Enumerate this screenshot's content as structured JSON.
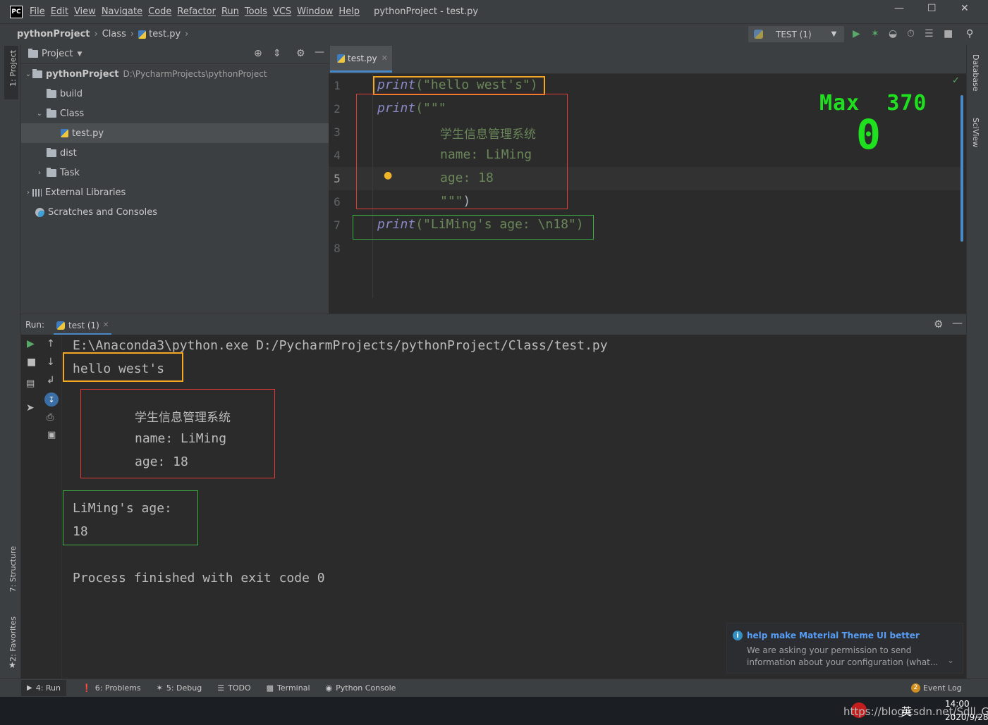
{
  "titlebar": {
    "app_icon": "PC",
    "menu": [
      "File",
      "Edit",
      "View",
      "Navigate",
      "Code",
      "Refactor",
      "Run",
      "Tools",
      "VCS",
      "Window",
      "Help"
    ],
    "title": "pythonProject - test.py"
  },
  "breadcrumb": {
    "project": "pythonProject",
    "folder": "Class",
    "file": "test.py"
  },
  "run_config": {
    "label": "TEST (1)"
  },
  "left_strip": {
    "project_tab": "1: Project",
    "structure_tab": "7: Structure",
    "favorites_tab": "2: Favorites"
  },
  "right_strip": {
    "database_tab": "Database",
    "sciview_tab": "SciView"
  },
  "project_panel": {
    "title": "Project",
    "root": {
      "name": "pythonProject",
      "path": "D:\\PycharmProjects\\pythonProject"
    },
    "items": {
      "build": "build",
      "class": "Class",
      "testpy": "test.py",
      "dist": "dist",
      "task": "Task",
      "external": "External Libraries",
      "scratches": "Scratches and Consoles"
    }
  },
  "editor": {
    "tab": "test.py",
    "line_numbers": [
      "1",
      "2",
      "3",
      "4",
      "5",
      "6",
      "7",
      "8"
    ],
    "lines": {
      "l1_kw": "print",
      "l1_rest": "(\"hello west's\")",
      "l2_kw": "print",
      "l2_rest": "(\"\"\"",
      "l3": "学生信息管理系统",
      "l4": "name: LiMing",
      "l5": "age: 18",
      "l6_str": "\"\"\"",
      "l6_rest": ")",
      "l7_kw": "print",
      "l7_str": "(\"LiMing's age: \\n18\")"
    },
    "overlay": {
      "max_label": "Max",
      "max_value": "370",
      "current": "0"
    }
  },
  "run": {
    "label": "Run:",
    "tab": "test (1)",
    "command": "E:\\Anaconda3\\python.exe D:/PycharmProjects/pythonProject/Class/test.py",
    "out1": "hello west's",
    "out2": "学生信息管理系统",
    "out3": "name: LiMing",
    "out4": "age: 18",
    "out5": "LiMing's age:",
    "out6": "18",
    "finish": "Process finished with exit code 0"
  },
  "notification": {
    "title": "help make Material Theme UI better",
    "body1": "We are asking your permission to send",
    "body2": "information about your configuration (what..."
  },
  "bottom_tabs": {
    "run": "4: Run",
    "problems": "6: Problems",
    "debug": "5: Debug",
    "todo": "TODO",
    "terminal": "Terminal",
    "console": "Python Console",
    "eventlog": "Event Log",
    "eventlog_count": "2"
  },
  "taskbar": {
    "url": "https://blog.csdn.net/Sdll_G",
    "ime": "英",
    "time": "14:00",
    "date": "2020/9/28"
  },
  "colors": {
    "orange_box": "#f5a623",
    "red_box": "#e53935",
    "green_box": "#3cb043",
    "overlay_green": "#1fe01f",
    "accent_blue": "#4a88c7"
  }
}
